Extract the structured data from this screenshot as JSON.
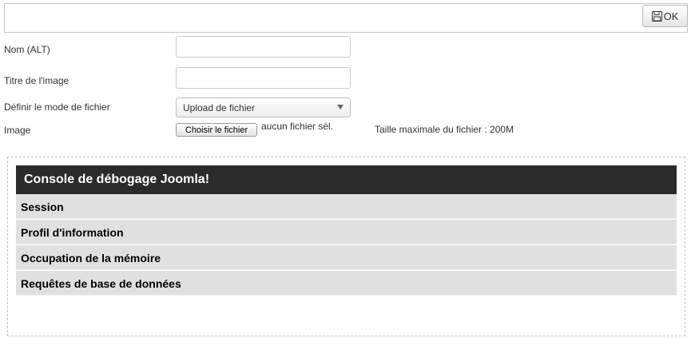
{
  "toolbar": {
    "ok_label": "OK",
    "ok_icon": "save-icon"
  },
  "form": {
    "alt_label": "Nom (ALT)",
    "alt_value": "",
    "title_label": "Titre de l'image",
    "title_value": "",
    "mode_label": "Définir le mode de fichier",
    "mode_value": "Upload de fichier",
    "image_label": "Image",
    "file_button_label": "Choisir le fichier",
    "file_status": "aucun fichier sél.",
    "max_size_text": "Taille maximale du fichier : 200M"
  },
  "debug": {
    "title": "Console de débogage Joomla!",
    "items": [
      "Session",
      "Profil d'information",
      "Occupation de la mémoire",
      "Requêtes de base de données"
    ]
  },
  "colors": {
    "debug_header_bg": "#2b2b2b",
    "debug_item_bg": "#e0e0e0"
  }
}
